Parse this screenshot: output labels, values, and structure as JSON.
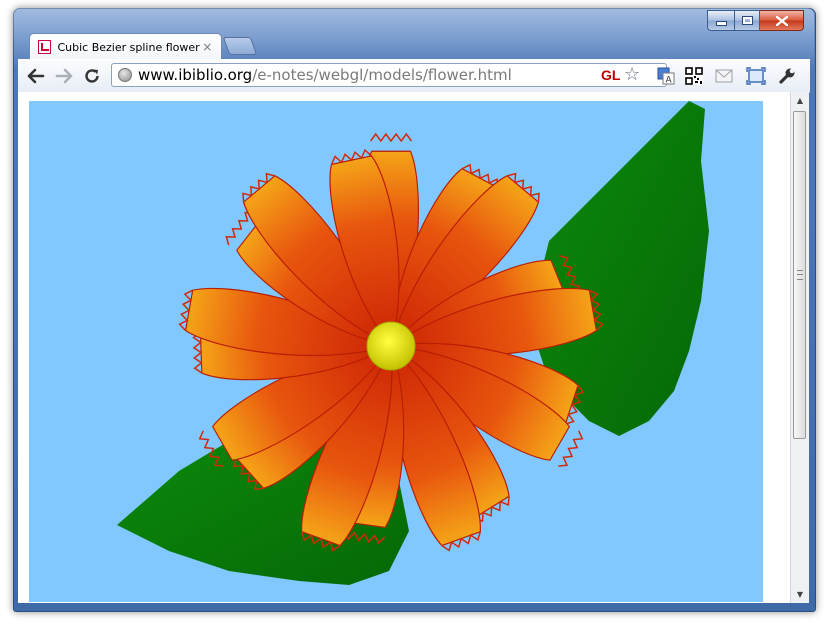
{
  "browser": {
    "tab": {
      "title": "Cubic Bezier spline flower",
      "close_glyph": "×",
      "favicon": "webgl-page-icon"
    },
    "newtab_icon": "new-tab-icon",
    "nav": {
      "back_icon": "back-arrow-icon",
      "forward_icon": "forward-arrow-icon",
      "reload_icon": "reload-icon"
    },
    "address": {
      "host": "www.ibiblio.org",
      "path": "/e-notes/webgl/models/flower.html",
      "page_icon": "globe-icon"
    },
    "gl_badge": "GL",
    "bookmark_icon": "star-icon",
    "extensions": [
      "translate-icon",
      "qr-code-icon",
      "mail-icon",
      "fullscreen-icon",
      "wrench-icon"
    ],
    "window_controls": [
      "minimize-icon",
      "maximize-icon",
      "close-icon"
    ]
  },
  "canvas": {
    "background": "#80c8ff",
    "leaf_color": "#0a7a0a",
    "petal_color": "#e0300a",
    "petal_inner_color": "#f39a1a",
    "center_color": "#e6e600"
  }
}
